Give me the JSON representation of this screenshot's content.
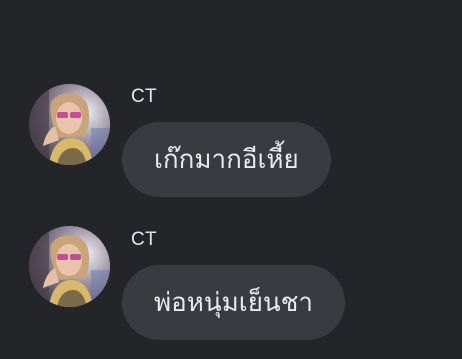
{
  "colors": {
    "background": "#242529",
    "bubble": "#3a3b40",
    "bubble_text": "#e9eaee",
    "sender_text": "#e4e6eb"
  },
  "messages": [
    {
      "sender": "CT",
      "text": "เก๊กมากอีเหี้ย",
      "avatar_icon": "profile-photo-avatar"
    },
    {
      "sender": "CT",
      "text": "พ่อหนุ่มเย็นชา",
      "avatar_icon": "profile-photo-avatar"
    }
  ]
}
